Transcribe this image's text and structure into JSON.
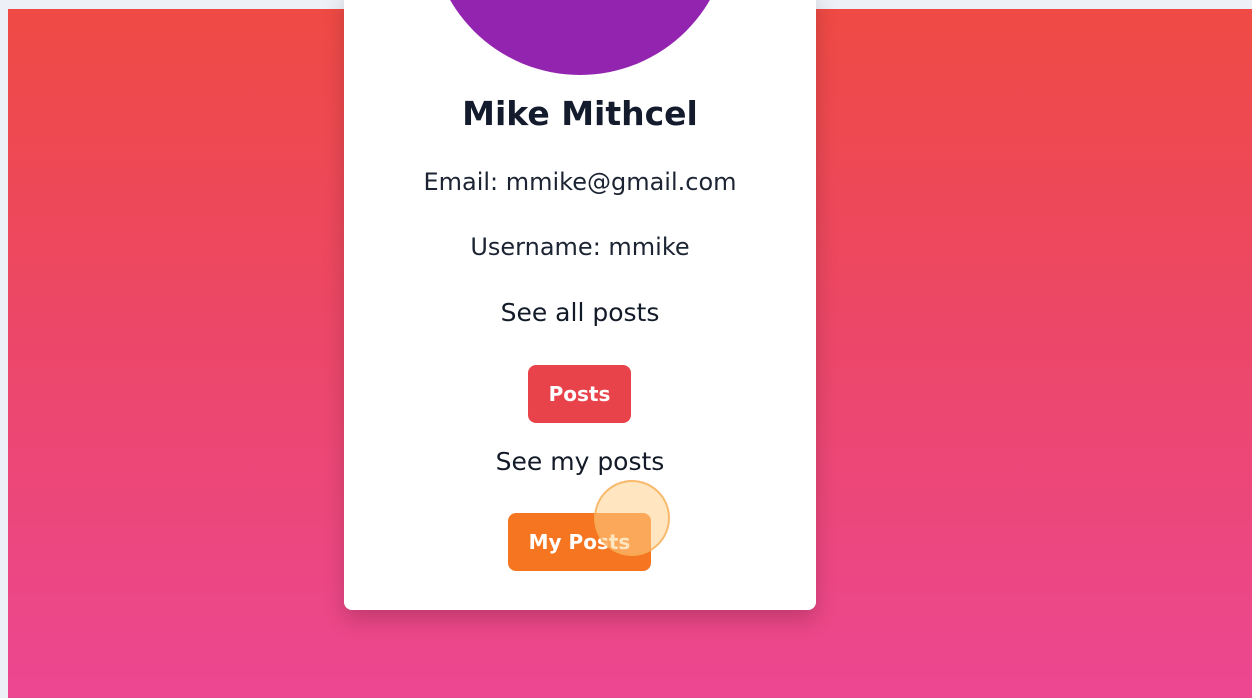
{
  "profile": {
    "name": "Mike Mithcel",
    "email_line": "Email: mmike@gmail.com",
    "username_line": "Username: mmike"
  },
  "posts_section": {
    "see_all_label": "See all posts",
    "posts_button": "Posts",
    "see_my_label": "See my posts",
    "my_posts_button": "My Posts"
  },
  "colors": {
    "gradient_top": "#ef4a44",
    "gradient_bottom": "#ec4791",
    "avatar": "#9324b0",
    "posts_button": "#e8434a",
    "my_posts_button": "#f57521"
  }
}
